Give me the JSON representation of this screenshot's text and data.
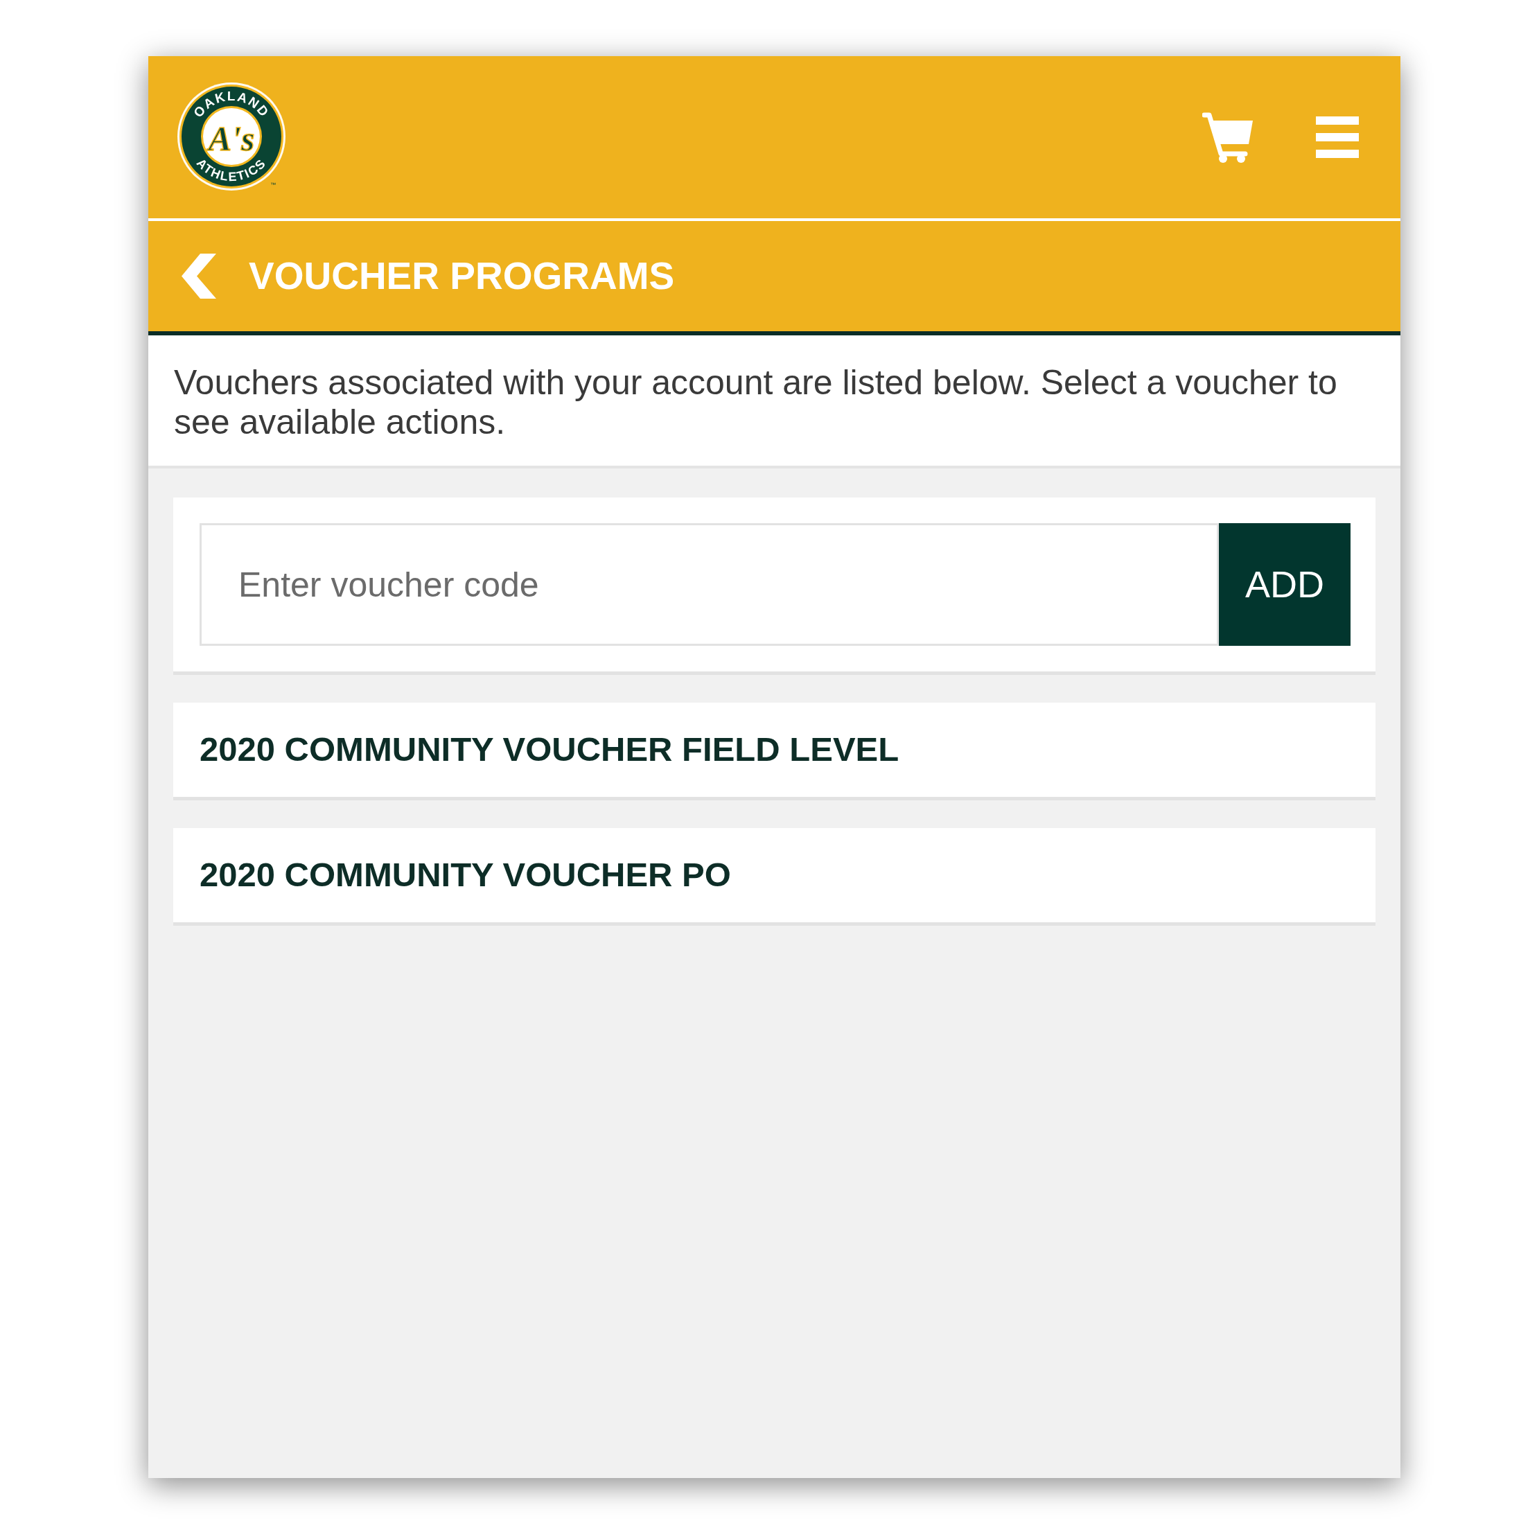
{
  "header": {
    "logo": {
      "top_text": "OAKLAND",
      "monogram": "A's",
      "bottom_text": "ATHLETICS",
      "trademark": "™"
    }
  },
  "title_bar": {
    "title": "VOUCHER PROGRAMS"
  },
  "intro": "Vouchers associated with your account are listed below. Select a voucher to see available actions.",
  "voucher_form": {
    "placeholder": "Enter voucher code",
    "button": "ADD"
  },
  "vouchers": [
    {
      "name": "2020 COMMUNITY VOUCHER FIELD LEVEL",
      "selected": false
    },
    {
      "name": "2020 COMMUNITY VOUCHER PO",
      "selected": false
    }
  ]
}
